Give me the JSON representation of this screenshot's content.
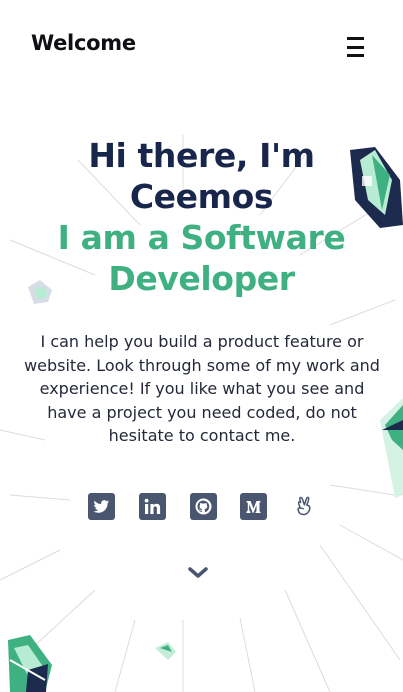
{
  "header": {
    "brand": "Welcome",
    "menu_icon": "hamburger-menu-icon"
  },
  "hero": {
    "greeting_line1": "Hi there, I'm",
    "greeting_line2": "Ceemos",
    "role_line1": "I am a Software",
    "role_line2": "Developer"
  },
  "bio": {
    "text": "I can help you build a product feature or website. Look through some of my work and experience! If you like what you see and have a project you need coded, do not hesitate to contact me."
  },
  "socials": [
    {
      "name": "twitter",
      "icon": "twitter-icon"
    },
    {
      "name": "linkedin",
      "icon": "linkedin-icon"
    },
    {
      "name": "github",
      "icon": "github-icon"
    },
    {
      "name": "medium",
      "icon": "medium-icon"
    },
    {
      "name": "angellist",
      "icon": "angellist-icon"
    }
  ],
  "scroll": {
    "icon": "chevron-down-icon"
  },
  "colors": {
    "heading": "#17264a",
    "accent": "#3fb081",
    "icon": "#4a5570"
  }
}
